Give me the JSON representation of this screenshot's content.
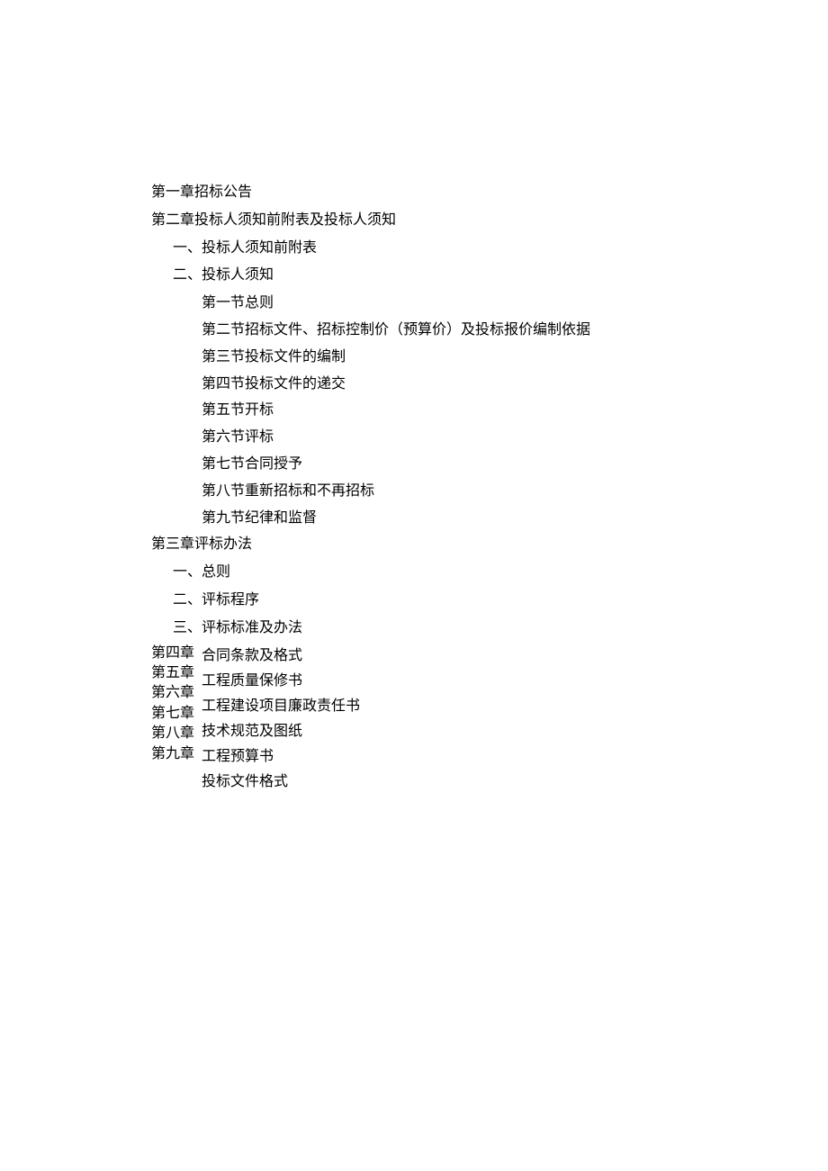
{
  "toc": {
    "ch1": "第一章招标公告",
    "ch2": "第二章投标人须知前附表及投标人须知",
    "ch2_sub1": "一、投标人须知前附表",
    "ch2_sub2": "二、投标人须知",
    "ch2_sec1": "第一节总则",
    "ch2_sec2": "第二节招标文件、招标控制价（预算价）及投标报价编制依据",
    "ch2_sec3": "第三节投标文件的编制",
    "ch2_sec4": "第四节投标文件的递交",
    "ch2_sec5": "第五节开标",
    "ch2_sec6": "第六节评标",
    "ch2_sec7": "第七节合同授予",
    "ch2_sec8": "第八节重新招标和不再招标",
    "ch2_sec9": "第九节纪律和监督",
    "ch3": "第三章评标办法",
    "ch3_sub1": "一、总则",
    "ch3_sub2": "二、评标程序",
    "ch3_sub3": "三、评标标准及办法",
    "ch4_label": "第四章",
    "ch5_label": "第五章",
    "ch6_label": "第六章",
    "ch7_label": "第七章",
    "ch8_label": "第八章",
    "ch9_label": "第九章",
    "ch4_title": "合同条款及格式",
    "ch5_title": "工程质量保修书",
    "ch6_title": "工程建设项目廉政责任书",
    "ch7_title": "技术规范及图纸",
    "ch8_title": "工程预算书",
    "ch9_title": "投标文件格式"
  }
}
